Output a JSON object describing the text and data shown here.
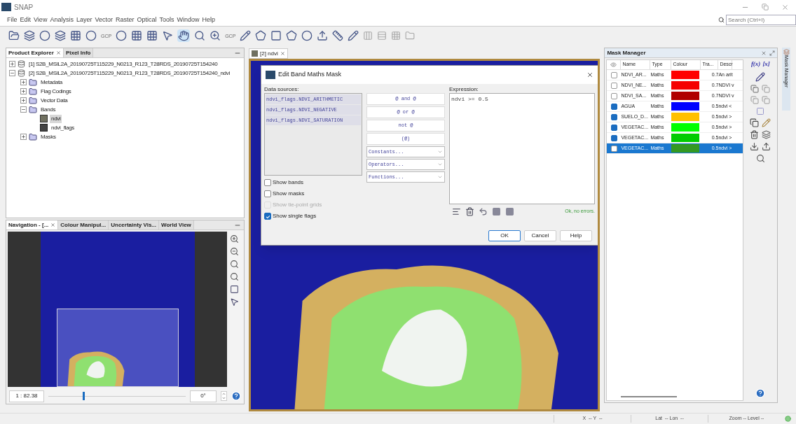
{
  "window": {
    "title": "SNAP"
  },
  "menu": [
    "File",
    "Edit",
    "View",
    "Analysis",
    "Layer",
    "Vector",
    "Raster",
    "Optical",
    "Tools",
    "Window",
    "Help"
  ],
  "search": {
    "placeholder": "Search (Ctrl+I)"
  },
  "toolbar": {
    "gcp_labels": [
      "GCP",
      "GCP"
    ]
  },
  "product_explorer": {
    "tabs": [
      {
        "label": "Product Explorer",
        "selected": true
      },
      {
        "label": "Pixel Info",
        "selected": false
      }
    ],
    "tree": [
      {
        "label": "[1] S2B_MSIL2A_20190725T115229_N0213_R123_T28RDS_20190725T154240",
        "kind": "product",
        "expanded": false,
        "selected": false
      },
      {
        "label": "[2] S2B_MSIL2A_20190725T115229_N0213_R123_T28RDS_20190725T154240_ndvi",
        "kind": "product",
        "expanded": true,
        "selected": false,
        "children": [
          {
            "label": "Metadata",
            "kind": "folder",
            "expanded": false,
            "selected": false
          },
          {
            "label": "Flag Codings",
            "kind": "folder",
            "expanded": false,
            "selected": false
          },
          {
            "label": "Vector Data",
            "kind": "folder",
            "expanded": false,
            "selected": false
          },
          {
            "label": "Bands",
            "kind": "folder",
            "expanded": true,
            "selected": false,
            "children": [
              {
                "label": "ndvi",
                "kind": "band",
                "selected": true
              },
              {
                "label": "ndvi_flags",
                "kind": "flag_band",
                "selected": false
              }
            ]
          },
          {
            "label": "Masks",
            "kind": "folder",
            "expanded": false,
            "selected": false
          }
        ]
      }
    ]
  },
  "navigation": {
    "tabs": [
      {
        "label": "Navigation - [...",
        "selected": true
      },
      {
        "label": "Colour Manipul...",
        "selected": false
      },
      {
        "label": "Uncertainty Vis...",
        "selected": false
      },
      {
        "label": "World View",
        "selected": false
      }
    ],
    "scale": "1 : 82.38",
    "zoom": {
      "level": 0.25
    },
    "rotation": "0°"
  },
  "image_view": {
    "tab": "[2] ndvi"
  },
  "dialog": {
    "title": "Edit Band Maths Mask",
    "sources_label": "Data sources:",
    "sources": [
      "ndvi_flags.NDVI_ARITHMETIC",
      "ndvi_flags.NDVI_NEGATIVE",
      "ndvi_flags.NDVI_SATURATION"
    ],
    "operator_buttons": [
      "@ and @",
      "@ or @",
      "not @",
      "(@)"
    ],
    "dropdowns": [
      "Constants...",
      "Operators...",
      "Functions..."
    ],
    "options": [
      {
        "label": "Show bands",
        "checked": false,
        "disabled": false
      },
      {
        "label": "Show masks",
        "checked": false,
        "disabled": false
      },
      {
        "label": "Show tie-point grids",
        "checked": false,
        "disabled": true
      },
      {
        "label": "Show single flags",
        "checked": true,
        "disabled": false
      }
    ],
    "expression_label": "Expression:",
    "expression": "ndvi >= 0.5",
    "status": "Ok, no errors.",
    "buttons": [
      {
        "label": "OK",
        "default": true
      },
      {
        "label": "Cancel",
        "default": false
      },
      {
        "label": "Help",
        "default": false
      }
    ]
  },
  "mask_manager": {
    "title": "Mask Manager",
    "side_tab": "Mask Manager",
    "columns": [
      "Name",
      "Type",
      "Colour",
      "Tra...",
      "Descr"
    ],
    "tool_labels": [
      "f(x)",
      "[x]"
    ],
    "rows": [
      {
        "visible": false,
        "name": "NDVI_AR...",
        "type": "Maths",
        "color": "#ff0000",
        "transparency": "0.7",
        "description": "An arit",
        "selected": false
      },
      {
        "visible": false,
        "name": "NDVI_NE...",
        "type": "Maths",
        "color": "#f50000",
        "transparency": "0.7",
        "description": "NDVI v",
        "selected": false
      },
      {
        "visible": false,
        "name": "NDVI_SA...",
        "type": "Maths",
        "color": "#b00000",
        "transparency": "0.7",
        "description": "NDVI v",
        "selected": false
      },
      {
        "visible": true,
        "name": "AGUA",
        "type": "Maths",
        "color": "#0000ff",
        "transparency": "0.5",
        "description": "ndvi <",
        "selected": false
      },
      {
        "visible": true,
        "name": "SUELO_D...",
        "type": "Maths",
        "color": "#ffc000",
        "transparency": "0.5",
        "description": "ndvi >",
        "selected": false
      },
      {
        "visible": true,
        "name": "VEGETAC...",
        "type": "Maths",
        "color": "#00ff00",
        "transparency": "0.5",
        "description": "ndvi >",
        "selected": false
      },
      {
        "visible": true,
        "name": "VEGETAC...",
        "type": "Maths",
        "color": "#00cc00",
        "transparency": "0.5",
        "description": "ndvi >",
        "selected": false
      },
      {
        "visible": false,
        "name": "VEGETAC...",
        "type": "Maths",
        "color": "#339922",
        "transparency": "0.5",
        "description": "ndvi >",
        "selected": true
      }
    ]
  },
  "status_bar": [
    "X  -- Y  --",
    "Lat  -- Lon  --",
    "Zoom -- Level --"
  ]
}
